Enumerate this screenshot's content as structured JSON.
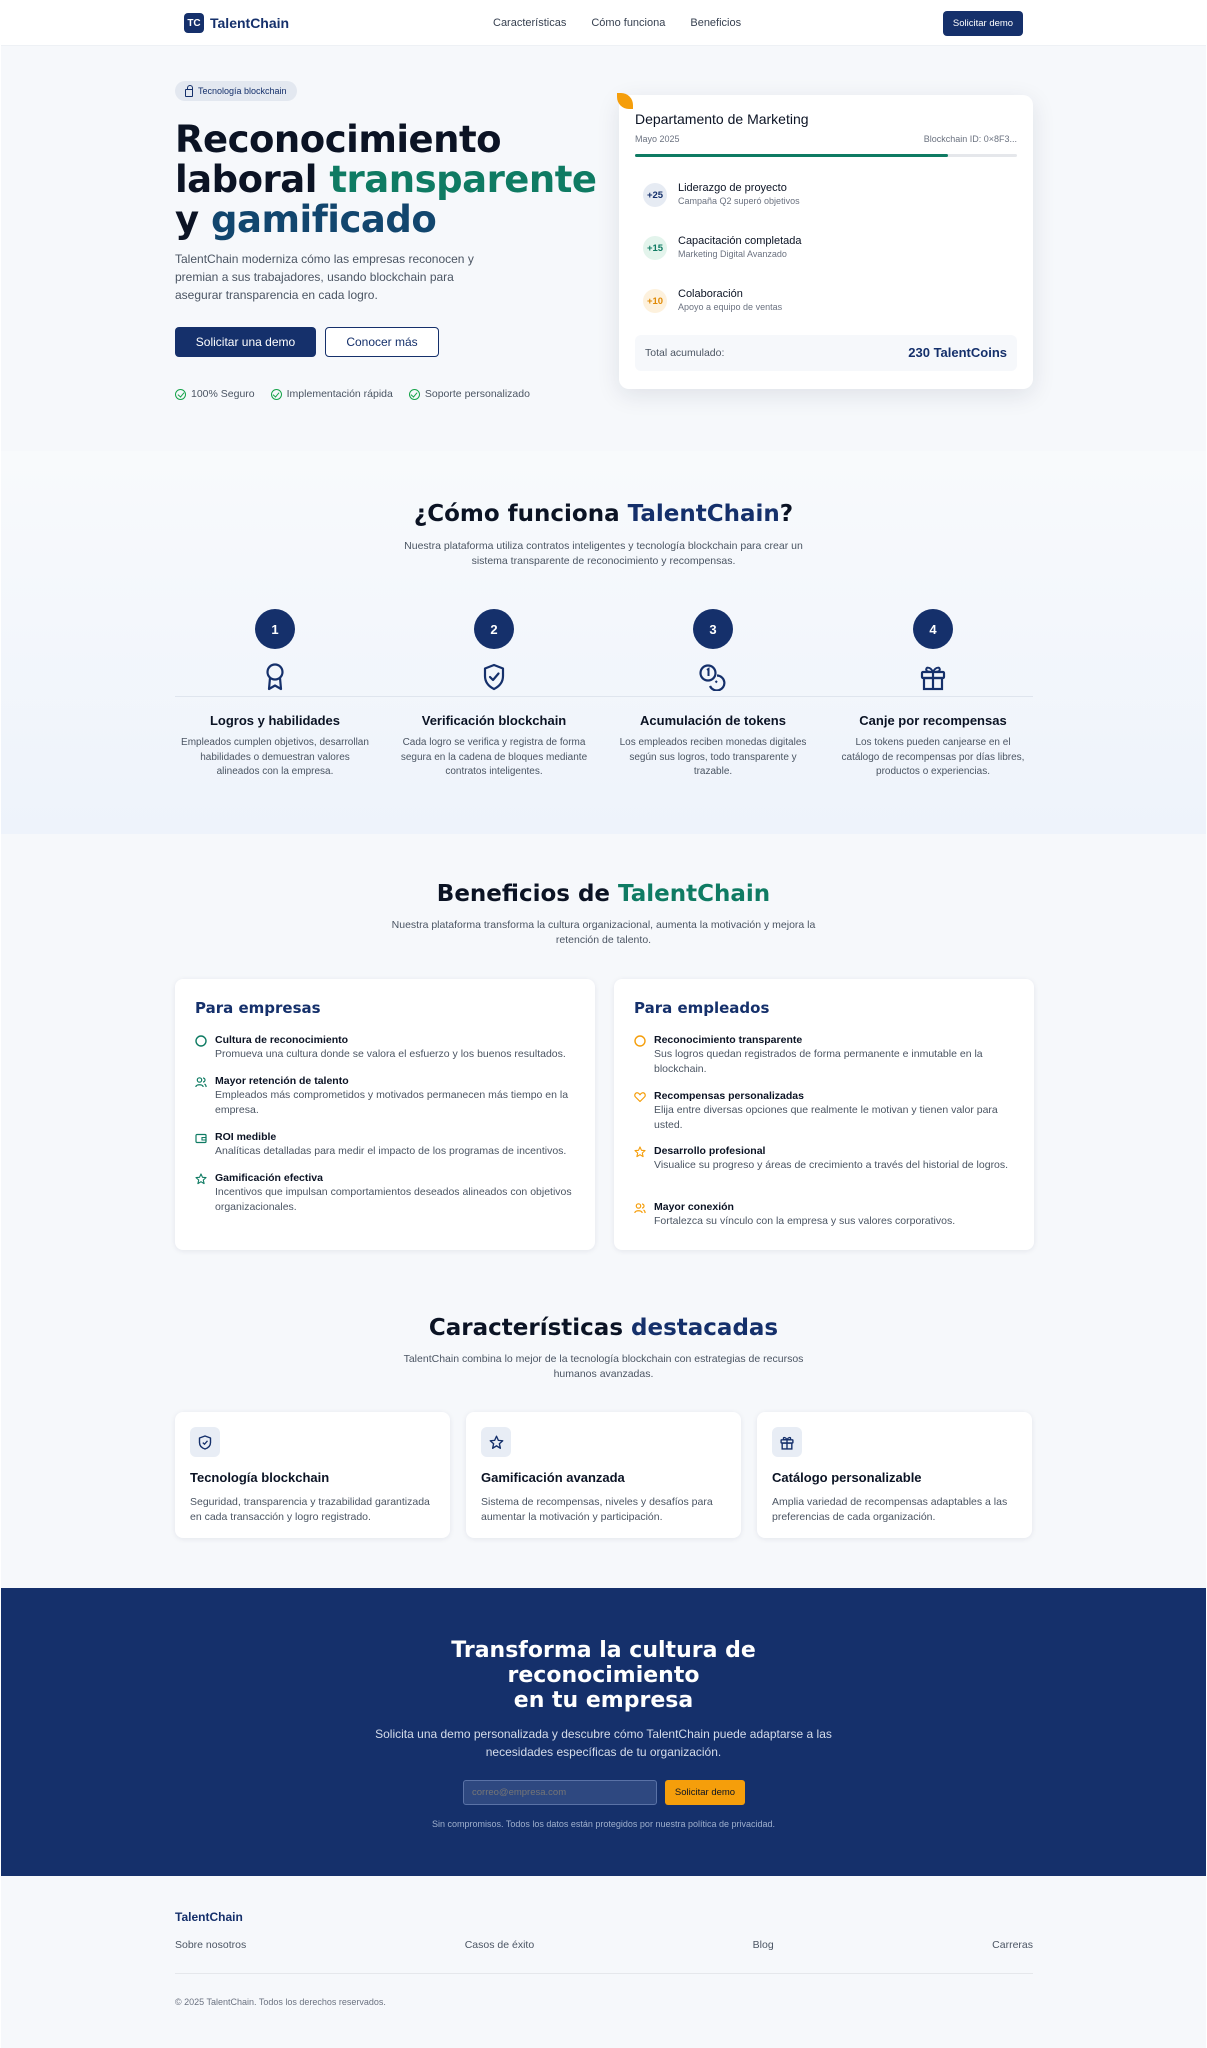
{
  "nav": {
    "logo_mark": "TC",
    "logo_text": "TalentChain",
    "links": [
      "Características",
      "Cómo funciona",
      "Beneficios"
    ],
    "cta": "Solicitar demo"
  },
  "hero": {
    "badge": "Tecnología blockchain",
    "title_line1": "Reconocimiento",
    "title_line2_a": "laboral ",
    "title_line2_b": "transparente",
    "title_line3_a": "y ",
    "title_line3_b": "gamificado",
    "subtitle": "TalentChain moderniza cómo las empresas reconocen y premian a sus trabajadores, usando blockchain para asegurar transparencia en cada logro.",
    "primary_button": "Solicitar una demo",
    "secondary_button": "Conocer más",
    "checks": [
      "100% Seguro",
      "Implementación rápida",
      "Soporte personalizado"
    ]
  },
  "card": {
    "title": "Departamento de Marketing",
    "date": "Mayo 2025",
    "blockchain_id": "Blockchain ID: 0×8F3...",
    "progress": 0.82,
    "achievements": [
      {
        "points": "+25",
        "title": "Liderazgo de proyecto",
        "desc": "Campaña Q2 superó objetivos"
      },
      {
        "points": "+15",
        "title": "Capacitación completada",
        "desc": "Marketing Digital Avanzado"
      },
      {
        "points": "+10",
        "title": "Colaboración",
        "desc": "Apoyo a equipo de ventas"
      }
    ],
    "total_label": "Total acumulado:",
    "total_value": "230 TalentCoins"
  },
  "how": {
    "title_a": "¿Cómo funciona ",
    "title_b": "TalentChain",
    "title_c": "?",
    "subtitle": "Nuestra plataforma utiliza contratos inteligentes y tecnología blockchain para crear un sistema transparente de reconocimiento y recompensas.",
    "steps": [
      {
        "num": "1",
        "title": "Logros y habilidades",
        "desc": "Empleados cumplen objetivos, desarrollan habilidades o demuestran valores alineados con la empresa."
      },
      {
        "num": "2",
        "title": "Verificación blockchain",
        "desc": "Cada logro se verifica y registra de forma segura en la cadena de bloques mediante contratos inteligentes."
      },
      {
        "num": "3",
        "title": "Acumulación de tokens",
        "desc": "Los empleados reciben monedas digitales según sus logros, todo transparente y trazable."
      },
      {
        "num": "4",
        "title": "Canje por recompensas",
        "desc": "Los tokens pueden canjearse en el catálogo de recompensas por días libres, productos o experiencias."
      }
    ]
  },
  "benefits": {
    "title_a": "Beneficios de ",
    "title_b": "TalentChain",
    "subtitle": "Nuestra plataforma transforma la cultura organizacional, aumenta la motivación y mejora la retención de talento.",
    "companies": {
      "title": "Para empresas",
      "items": [
        {
          "title": "Cultura de reconocimiento",
          "desc": "Promueva una cultura donde se valora el esfuerzo y los buenos resultados."
        },
        {
          "title": "Mayor retención de talento",
          "desc": "Empleados más comprometidos y motivados permanecen más tiempo en la empresa."
        },
        {
          "title": "ROI medible",
          "desc": "Analíticas detalladas para medir el impacto de los programas de incentivos."
        },
        {
          "title": "Gamificación efectiva",
          "desc": "Incentivos que impulsan comportamientos deseados alineados con objetivos organizacionales."
        }
      ]
    },
    "employees": {
      "title": "Para empleados",
      "items": [
        {
          "title": "Reconocimiento transparente",
          "desc": "Sus logros quedan registrados de forma permanente e inmutable en la blockchain."
        },
        {
          "title": "Recompensas personalizadas",
          "desc": "Elija entre diversas opciones que realmente le motivan y tienen valor para usted."
        },
        {
          "title": "Desarrollo profesional",
          "desc": "Visualice su progreso y áreas de crecimiento a través del historial de logros."
        },
        {
          "title": "Mayor conexión",
          "desc": "Fortalezca su vínculo con la empresa y sus valores corporativos."
        }
      ]
    }
  },
  "features": {
    "title_a": "Características ",
    "title_b": "destacadas",
    "subtitle": "TalentChain combina lo mejor de la tecnología blockchain con estrategias de recursos humanos avanzadas.",
    "items": [
      {
        "icon": "shield-icon",
        "title": "Tecnología blockchain",
        "desc": "Seguridad, transparencia y trazabilidad garantizada en cada transacción y logro registrado."
      },
      {
        "icon": "star-icon",
        "title": "Gamificación avanzada",
        "desc": "Sistema de recompensas, niveles y desafíos para aumentar la motivación y participación."
      },
      {
        "icon": "gift-icon",
        "title": "Catálogo personalizable",
        "desc": "Amplia variedad de recompensas adaptables a las preferencias de cada organización."
      }
    ]
  },
  "cta": {
    "title_line1": "Transforma la cultura de",
    "title_line2": "reconocimiento",
    "title_line3": "en tu empresa",
    "subtitle": "Solicita una demo personalizada y descubre cómo TalentChain puede adaptarse a las necesidades específicas de tu organización.",
    "email_placeholder": "correo@empresa.com",
    "button": "Solicitar demo",
    "note": "Sin compromisos. Todos los datos están protegidos por nuestra política de privacidad."
  },
  "footer": {
    "logo": "TalentChain",
    "links": [
      "Sobre nosotros",
      "Casos de éxito",
      "Blog",
      "Carreras"
    ],
    "copyright": "© 2025 TalentChain. Todos los derechos reservados."
  },
  "colors": {
    "primary": "#15306b",
    "green": "#0f7b63",
    "accent": "#f59e0b"
  }
}
